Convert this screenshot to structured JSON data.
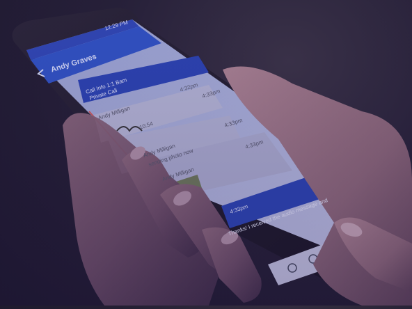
{
  "phone": {
    "status_time": "12:29 PM",
    "header_title": "Andy Graves",
    "messages": [
      {
        "time": "4:32pm",
        "line1": "Call Info 1:1 Bam",
        "line2": "Private Call"
      },
      {
        "time": "4:33pm",
        "sender": "Andy Milligan",
        "label": "10:54"
      },
      {
        "time": "4:33pm",
        "sender": "Andy Milligan",
        "text": "sending photo now"
      },
      {
        "time": "4:33pm",
        "sender": "Andy Milligan"
      },
      {
        "time": "4:33pm",
        "text": "Thanks! I received the audio message and"
      }
    ]
  }
}
